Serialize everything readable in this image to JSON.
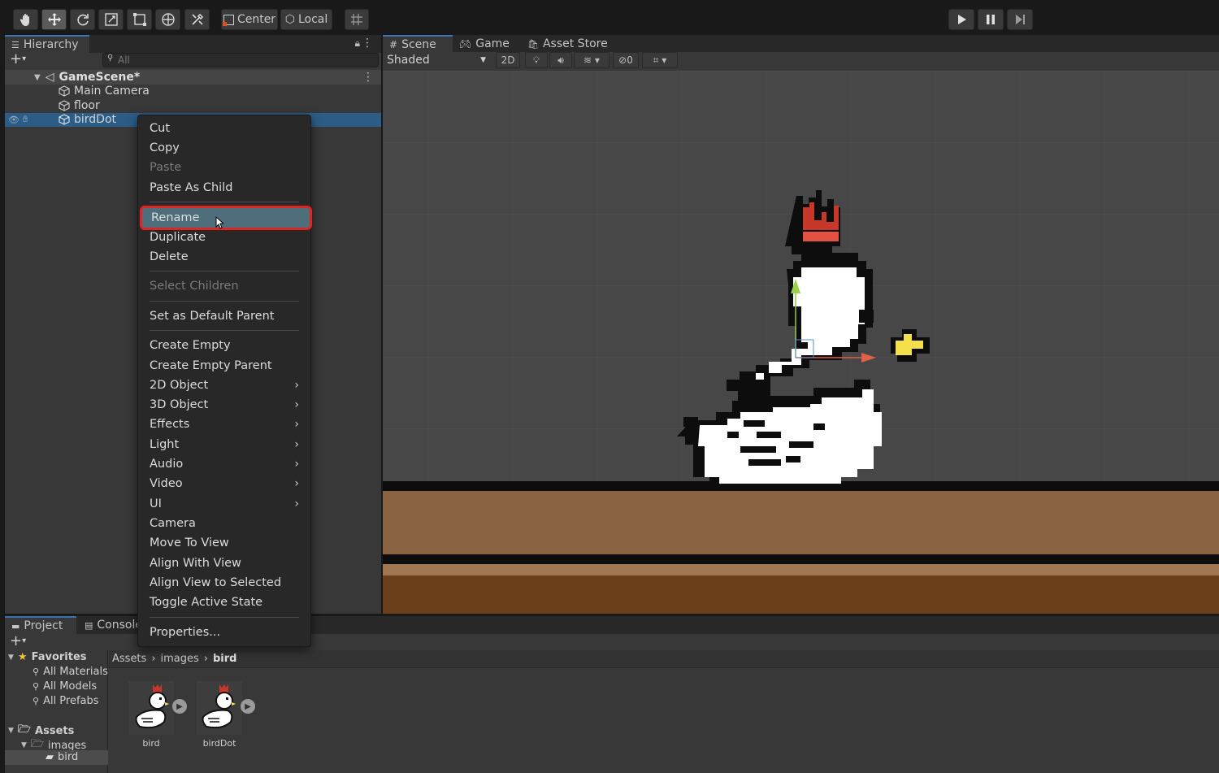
{
  "toolbar": {
    "tools": [
      "hand-tool",
      "move-tool",
      "rotate-tool",
      "scale-tool",
      "rect-tool",
      "transform-tool",
      "custom-tool"
    ],
    "pivot_label": "Center",
    "space_label": "Local"
  },
  "hierarchy": {
    "tab_label": "Hierarchy",
    "search_placeholder": "All",
    "scene_name": "GameScene*",
    "items": [
      {
        "label": "Main Camera"
      },
      {
        "label": "floor"
      },
      {
        "label": "birdDot"
      }
    ]
  },
  "context_menu": {
    "items": [
      {
        "label": "Cut",
        "disabled": false
      },
      {
        "label": "Copy",
        "disabled": false
      },
      {
        "label": "Paste",
        "disabled": true
      },
      {
        "label": "Paste As Child",
        "disabled": false
      },
      {
        "label": "Rename",
        "disabled": false,
        "highlighted": true
      },
      {
        "label": "Duplicate",
        "disabled": false
      },
      {
        "label": "Delete",
        "disabled": false
      },
      {
        "label": "Select Children",
        "disabled": true
      },
      {
        "label": "Set as Default Parent",
        "disabled": false
      },
      {
        "label": "Create Empty",
        "disabled": false
      },
      {
        "label": "Create Empty Parent",
        "disabled": false
      },
      {
        "label": "2D Object",
        "submenu": true
      },
      {
        "label": "3D Object",
        "submenu": true
      },
      {
        "label": "Effects",
        "submenu": true
      },
      {
        "label": "Light",
        "submenu": true
      },
      {
        "label": "Audio",
        "submenu": true
      },
      {
        "label": "Video",
        "submenu": true
      },
      {
        "label": "UI",
        "submenu": true
      },
      {
        "label": "Camera"
      },
      {
        "label": "Move To View"
      },
      {
        "label": "Align With View"
      },
      {
        "label": "Align View to Selected"
      },
      {
        "label": "Toggle Active State"
      },
      {
        "label": "Properties..."
      }
    ]
  },
  "scene_view": {
    "tabs": [
      "Scene",
      "Game",
      "Asset Store"
    ],
    "shading_mode": "Shaded",
    "mode_2d": "2D",
    "hidden_count": "0"
  },
  "project": {
    "tabs": [
      "Project",
      "Console"
    ],
    "favorites_label": "Favorites",
    "favorites": [
      "All Materials",
      "All Models",
      "All Prefabs"
    ],
    "assets_label": "Assets",
    "images_label": "images",
    "bird_folder_label": "bird",
    "breadcrumb": [
      "Assets",
      "images",
      "bird"
    ],
    "assets": [
      {
        "label": "bird"
      },
      {
        "label": "birdDot"
      }
    ]
  },
  "colors": {
    "highlight_border": "#e02424",
    "selection": "#2c5d87",
    "floor_top": "#8a6442",
    "floor_bottom": "#6b3f1a",
    "crown": "#c8382a",
    "beak": "#f4e04a"
  }
}
